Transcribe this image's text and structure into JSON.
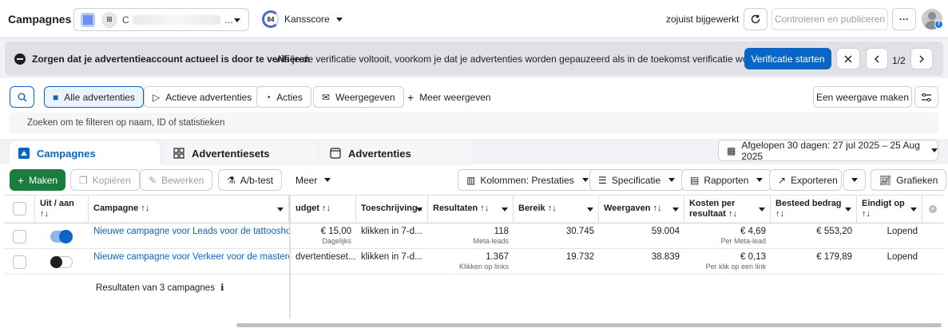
{
  "header": {
    "title": "Campagnes",
    "account_initial": "C",
    "account_badge": "⊞",
    "account_ellipsis": "...",
    "score_value": "84",
    "score_label": "Kansscore",
    "updated": "zojuist bijgewerkt",
    "review_label": "Controleren en publiceren",
    "more_label": "···"
  },
  "banner": {
    "bold": "Zorgen dat je advertentieaccount actueel is door te verifiëren",
    "text": "Als je de verificatie voltooit, voorkom je dat je advertenties worden gepauzeerd als in de toekomst verificatie wordt vereist.",
    "verify_label": "Verificatie starten",
    "pager": "1/2"
  },
  "filters": {
    "all_ads": "Alle advertenties",
    "active_ads": "Actieve advertenties",
    "actions": "Acties",
    "viewed": "Weergegeven",
    "more_views": "Meer weergeven",
    "make_view": "Een weergave maken",
    "search_placeholder": "Zoeken om te filteren op naam, ID of statistieken"
  },
  "tabs": {
    "campaigns": "Campagnes",
    "adsets": "Advertentiesets",
    "ads": "Advertenties",
    "date_range": "Afgelopen 30 dagen: 27 jul 2025 – 25 Aug 2025"
  },
  "toolbar": {
    "make": "Maken",
    "copy": "Kopiëren",
    "edit": "Bewerken",
    "ab_test": "A/b-test",
    "more": "Meer",
    "columns": "Kolommen: Prestaties",
    "specification": "Specificatie",
    "reports": "Rapporten",
    "export": "Exporteren",
    "charts": "Grafieken"
  },
  "table": {
    "headers": {
      "on_off": "Uit / aan",
      "on_off_sort": "↑↓",
      "campaign": "Campagne ↑↓",
      "budget": "udget ↑↓",
      "attribution": "Toeschrijving..",
      "results": "Resultaten ↑↓",
      "reach": "Bereik ↑↓",
      "impressions": "Weergaven ↑↓",
      "cost_per_result": "Kosten per",
      "cost_per_result_2": "resultaat ↑↓",
      "spent": "Besteed bedrag",
      "spent_sort": "↑↓",
      "ends": "Eindigt op",
      "ends_sort": "↑↓"
    },
    "rows": [
      {
        "campaign": "Nieuwe campagne voor Leads voor de tattooshop",
        "budget": "€ 15,00",
        "budget_sub": "Dagelijks",
        "attribution": "klikken in 7-d...",
        "results": "118",
        "results_sub": "Meta-leads",
        "reach": "30.745",
        "impressions": "59.004",
        "cost": "€ 4,69",
        "cost_sub": "Per Meta-lead",
        "spent": "€ 553,20",
        "ends": "Lopend"
      },
      {
        "campaign": "Nieuwe campagne voor Verkeer voor de mastercl...",
        "budget": "dvertentieset...",
        "budget_sub": "",
        "attribution": "klikken in 7-d...",
        "results": "1.367",
        "results_sub": "Klikken op links",
        "reach": "19.732",
        "impressions": "38.839",
        "cost": "€ 0,13",
        "cost_sub": "Per klik op een link",
        "spent": "€ 179,89",
        "ends": "Lopend"
      }
    ],
    "summary": "Resultaten van 3 campagnes"
  }
}
